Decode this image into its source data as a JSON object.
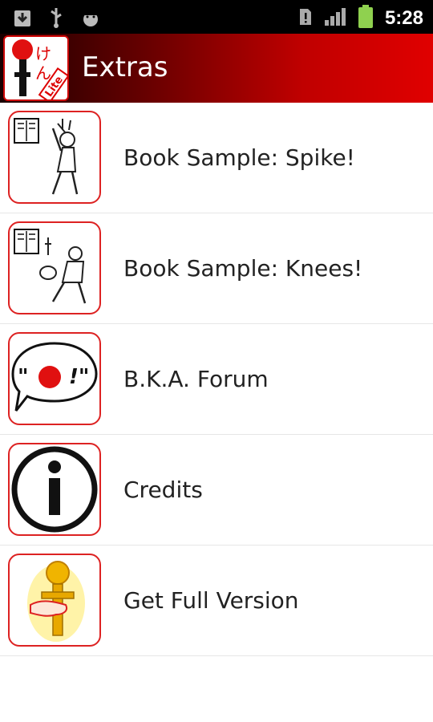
{
  "status_bar": {
    "time": "5:28",
    "icons": [
      "download-icon",
      "usb-icon",
      "android-debug-icon",
      "sim-alert-icon",
      "signal-icon",
      "battery-icon"
    ]
  },
  "header": {
    "title": "Extras",
    "logo_text": "けん Lite"
  },
  "items": [
    {
      "label": "Book Sample: Spike!",
      "icon": "book-sample-spike-icon"
    },
    {
      "label": "Book Sample: Knees!",
      "icon": "book-sample-knees-icon"
    },
    {
      "label": "B.K.A. Forum",
      "icon": "forum-speech-bubble-icon"
    },
    {
      "label": "Credits",
      "icon": "info-icon"
    },
    {
      "label": "Get Full Version",
      "icon": "kendama-hand-icon"
    }
  ],
  "colors": {
    "accent": "#d22222",
    "header_dark": "#1a0000",
    "header_bright": "#e00000"
  }
}
